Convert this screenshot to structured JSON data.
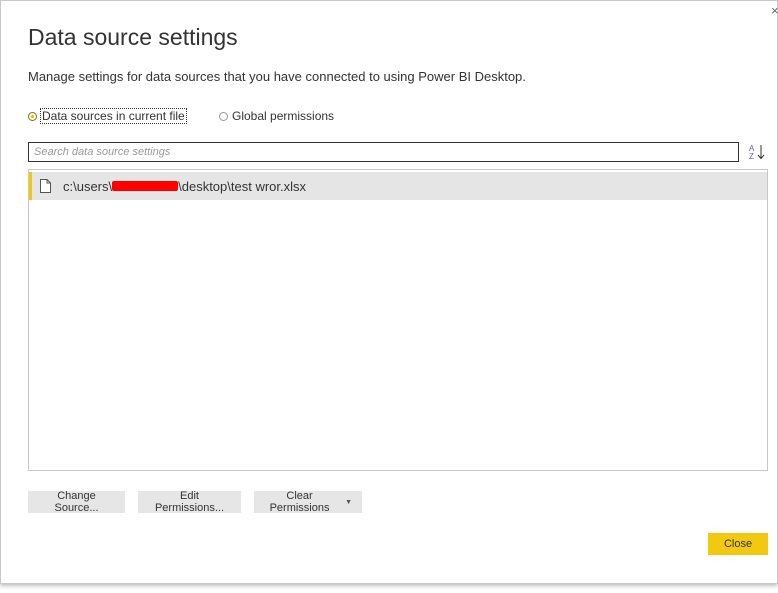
{
  "dialog": {
    "title": "Data source settings",
    "subtitle": "Manage settings for data sources that you have connected to using Power BI Desktop.",
    "close_glyph": "×"
  },
  "scope": {
    "options": [
      {
        "label": "Data sources in current file",
        "selected": true
      },
      {
        "label": "Global permissions",
        "selected": false
      }
    ]
  },
  "search": {
    "placeholder": "Search data source settings",
    "value": ""
  },
  "sources": {
    "items": [
      {
        "prefix": "c:\\users\\",
        "suffix": "\\desktop\\test wror.xlsx",
        "redacted": true
      }
    ]
  },
  "actions": {
    "change_source": "Change Source...",
    "edit_permissions": "Edit Permissions...",
    "clear_permissions": "Clear Permissions",
    "close": "Close"
  },
  "colors": {
    "accent": "#f2c811",
    "redaction": "#ff0000",
    "sort_icon": "#6b5bb5"
  }
}
